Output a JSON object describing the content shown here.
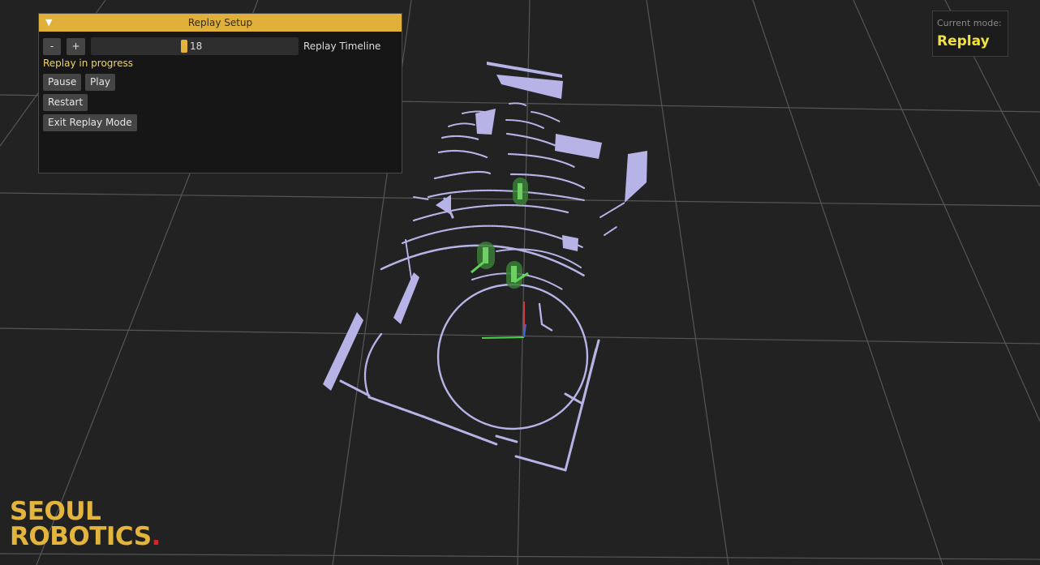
{
  "panel": {
    "title": "Replay Setup",
    "collapse_icon": "▼",
    "minus_label": "-",
    "plus_label": "+",
    "timeline_value": "18",
    "timeline_label": "Replay Timeline",
    "status": "Replay in progress",
    "pause_label": "Pause",
    "play_label": "Play",
    "restart_label": "Restart",
    "exit_label": "Exit Replay Mode"
  },
  "mode": {
    "label": "Current mode:",
    "value": "Replay"
  },
  "logo": {
    "line1": "SEOUL",
    "line2": "ROBOTICS",
    "dot": "."
  },
  "colors": {
    "accent": "#e0b03a",
    "point_cloud": "#b6b4e6",
    "tracked_object": "#4caf50",
    "mode_value": "#f2e23a",
    "status": "#f2d65e"
  },
  "icons": [
    "collapse-triangle-icon",
    "axis-gizmo-icon"
  ]
}
